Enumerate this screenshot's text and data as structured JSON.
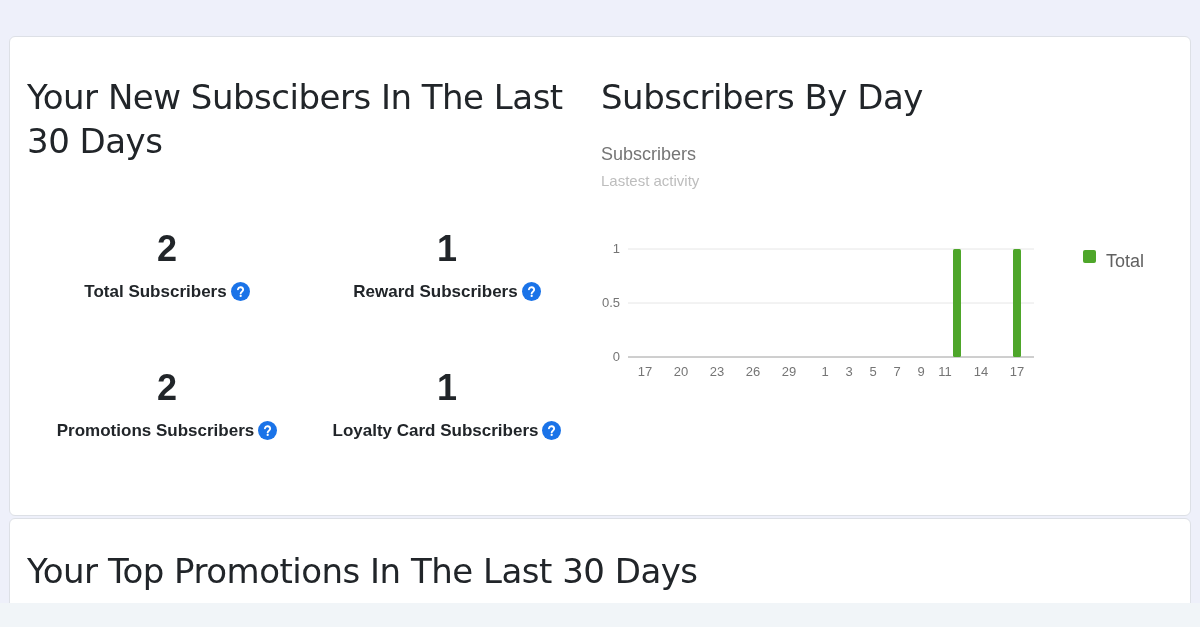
{
  "summary_card": {
    "title": "Your New Subscibers In The Last 30 Days",
    "stats": [
      {
        "value": "2",
        "label": "Total Subscribers"
      },
      {
        "value": "1",
        "label": "Reward Subscribers"
      },
      {
        "value": "2",
        "label": "Promotions Subscribers"
      },
      {
        "value": "1",
        "label": "Loyalty Card Subscribers"
      }
    ]
  },
  "chart_card": {
    "title": "Subscribers By Day",
    "chart_title": "Subscribers",
    "chart_subtitle": "Lastest activity",
    "chart_data": {
      "type": "bar",
      "categories": [
        "17",
        null,
        null,
        "20",
        null,
        null,
        "23",
        null,
        null,
        "26",
        null,
        null,
        "29",
        null,
        null,
        "1",
        null,
        "3",
        null,
        "5",
        null,
        "7",
        null,
        "9",
        null,
        "11",
        null,
        null,
        "14",
        null,
        null,
        "17"
      ],
      "series": [
        {
          "name": "Total",
          "color": "#4ea62a",
          "values": [
            0,
            0,
            0,
            0,
            0,
            0,
            0,
            0,
            0,
            0,
            0,
            0,
            0,
            0,
            0,
            0,
            0,
            0,
            0,
            0,
            0,
            0,
            0,
            0,
            0,
            0,
            1,
            0,
            0,
            0,
            0,
            1
          ]
        }
      ],
      "ylim": [
        0,
        1
      ],
      "yticks": [
        0,
        0.5,
        1
      ]
    }
  },
  "promotions_card": {
    "title": "Your Top Promotions In The Last 30 Days"
  }
}
